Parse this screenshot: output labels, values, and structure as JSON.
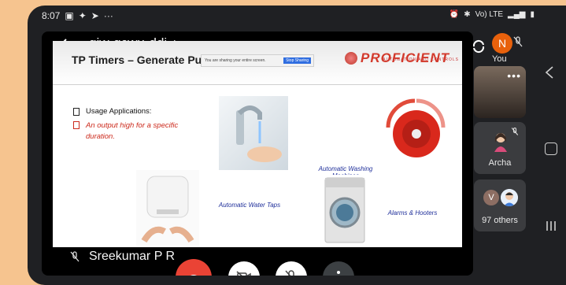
{
  "status_bar": {
    "time": "8:07",
    "right_text": "Vo) LTE",
    "left_icons": [
      "image-icon",
      "accessibility-icon",
      "send-icon",
      "more-icon"
    ],
    "right_icons": [
      "alarm-icon",
      "bluetooth-icon",
      "signal-icon",
      "wifi-icon",
      "battery-icon"
    ]
  },
  "meeting": {
    "code": "qiw-qcwu-ddi"
  },
  "slide": {
    "title": "TP Timers – Generate Pulse",
    "sharing_notice": "You are sharing your entire screen.",
    "sharing_stop": "Stop Sharing",
    "brand_name": "PROFICIENT",
    "brand_sub": "AUTOMATION AND CONTROLS",
    "bullet1": "Usage Applications:",
    "bullet2": "An output high for a specific duration.",
    "cap_dryers": "Hand dryers",
    "cap_water": "Automatic Water Taps",
    "cap_washing": "Automatic Washing Machines",
    "cap_alarms": "Alarms & Hooters"
  },
  "speaker": {
    "name": "Sreekumar P R"
  },
  "participants": {
    "you_initial": "N",
    "you_label": "You",
    "archa_label": "Archa",
    "others_initial": "V",
    "others_label": "97 others"
  },
  "colors": {
    "end_call": "#ea4335",
    "avatar_you": "#e8610c",
    "background": "#f6c48f"
  }
}
